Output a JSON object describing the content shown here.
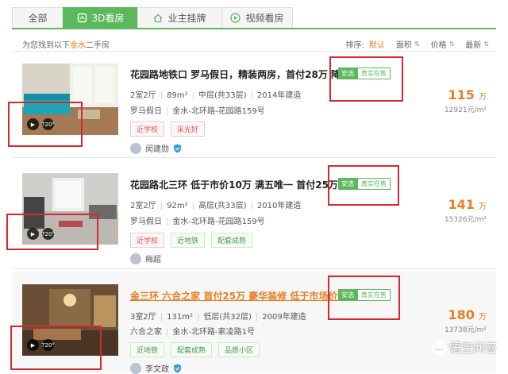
{
  "tabs": [
    {
      "label": "全部",
      "icon": ""
    },
    {
      "label": "3D看房",
      "icon": "3d-cube-icon"
    },
    {
      "label": "业主挂牌",
      "icon": "owner-icon"
    },
    {
      "label": "视频看房",
      "icon": "play-circle-icon"
    }
  ],
  "result": {
    "prefix": "为您找到以下",
    "keyword": "金水",
    "suffix": "二手房"
  },
  "sort": {
    "label": "排序:",
    "default": "默认",
    "area": "面积",
    "price": "价格",
    "newest": "最新"
  },
  "listings": [
    {
      "title": "花园路地铁口 罗马假日，精装两房，首付28万 降...",
      "tag_a": "安选",
      "tag_b": "真实在售",
      "layout": "2室2厅",
      "size": "89m²",
      "floor": "中层(共33层)",
      "year": "2014年建造",
      "estate": "罗马假日",
      "address": "金水-北环路-花园路159号",
      "features": [
        "近学校",
        "采光好"
      ],
      "agent": "闵建勋",
      "price": "115",
      "price_unit": "万",
      "unit_price": "12921元/m²",
      "vr_label": "720°"
    },
    {
      "title": "花园路北三环 低于市价10万 满五唯一 首付25万 ...",
      "tag_a": "安选",
      "tag_b": "真实在售",
      "layout": "2室2厅",
      "size": "92m²",
      "floor": "高层(共33层)",
      "year": "2010年建造",
      "estate": "罗马假日",
      "address": "金水-北环路-花园路159号",
      "features": [
        "近学校",
        "近地铁",
        "配套成熟"
      ],
      "agent": "梅超",
      "price": "141",
      "price_unit": "万",
      "unit_price": "15326元/m²",
      "vr_label": "720°"
    },
    {
      "title": "金三环 六合之家 首付25万 豪华装修 低于市场价2...",
      "tag_a": "安选",
      "tag_b": "真实在售",
      "layout": "3室2厅",
      "size": "131m²",
      "floor": "低层(共32层)",
      "year": "2009年建造",
      "estate": "六合之家",
      "address": "金水-北环路-索凌路1号",
      "features": [
        "近地铁",
        "配套成熟",
        "品质小区"
      ],
      "agent": "李文政",
      "price": "180",
      "price_unit": "万",
      "unit_price": "13738元/m²",
      "vr_label": "720°"
    }
  ],
  "watermark": "悟空问答",
  "colors": {
    "accent": "#5cb85c",
    "price": "#e67e22",
    "annotation": "#d9272e"
  }
}
